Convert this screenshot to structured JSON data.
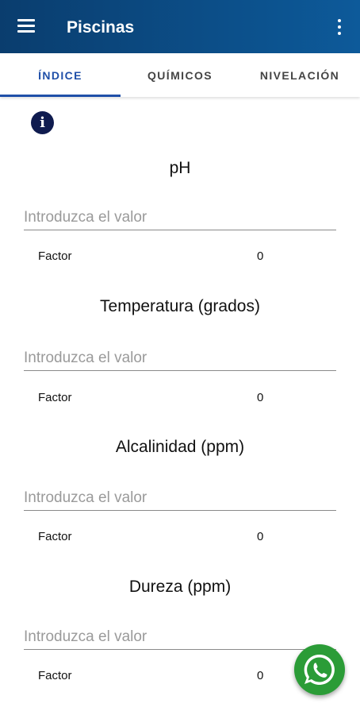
{
  "app": {
    "title": "Piscinas"
  },
  "icons": {
    "menu": "menu-icon",
    "more": "more-vert-icon",
    "info": "info-icon",
    "whatsapp": "whatsapp-icon"
  },
  "colors": {
    "appbar": "#0a3d6e",
    "tab_active": "#1f4fa8",
    "info_icon": "#0f1b4f",
    "whatsapp": "#2b9c37"
  },
  "tabs": [
    {
      "label": "ÍNDICE",
      "active": true
    },
    {
      "label": "QUÍMICOS",
      "active": false
    },
    {
      "label": "NIVELACIÓN",
      "active": false
    }
  ],
  "params": [
    {
      "title": "pH",
      "placeholder": "Introduzca el valor",
      "value": "",
      "factor_label": "Factor",
      "factor_value": "0"
    },
    {
      "title": "Temperatura (grados)",
      "placeholder": "Introduzca el valor",
      "value": "",
      "factor_label": "Factor",
      "factor_value": "0"
    },
    {
      "title": "Alcalinidad (ppm)",
      "placeholder": "Introduzca el valor",
      "value": "",
      "factor_label": "Factor",
      "factor_value": "0"
    },
    {
      "title": "Dureza (ppm)",
      "placeholder": "Introduzca el valor",
      "value": "",
      "factor_label": "Factor",
      "factor_value": "0"
    }
  ]
}
